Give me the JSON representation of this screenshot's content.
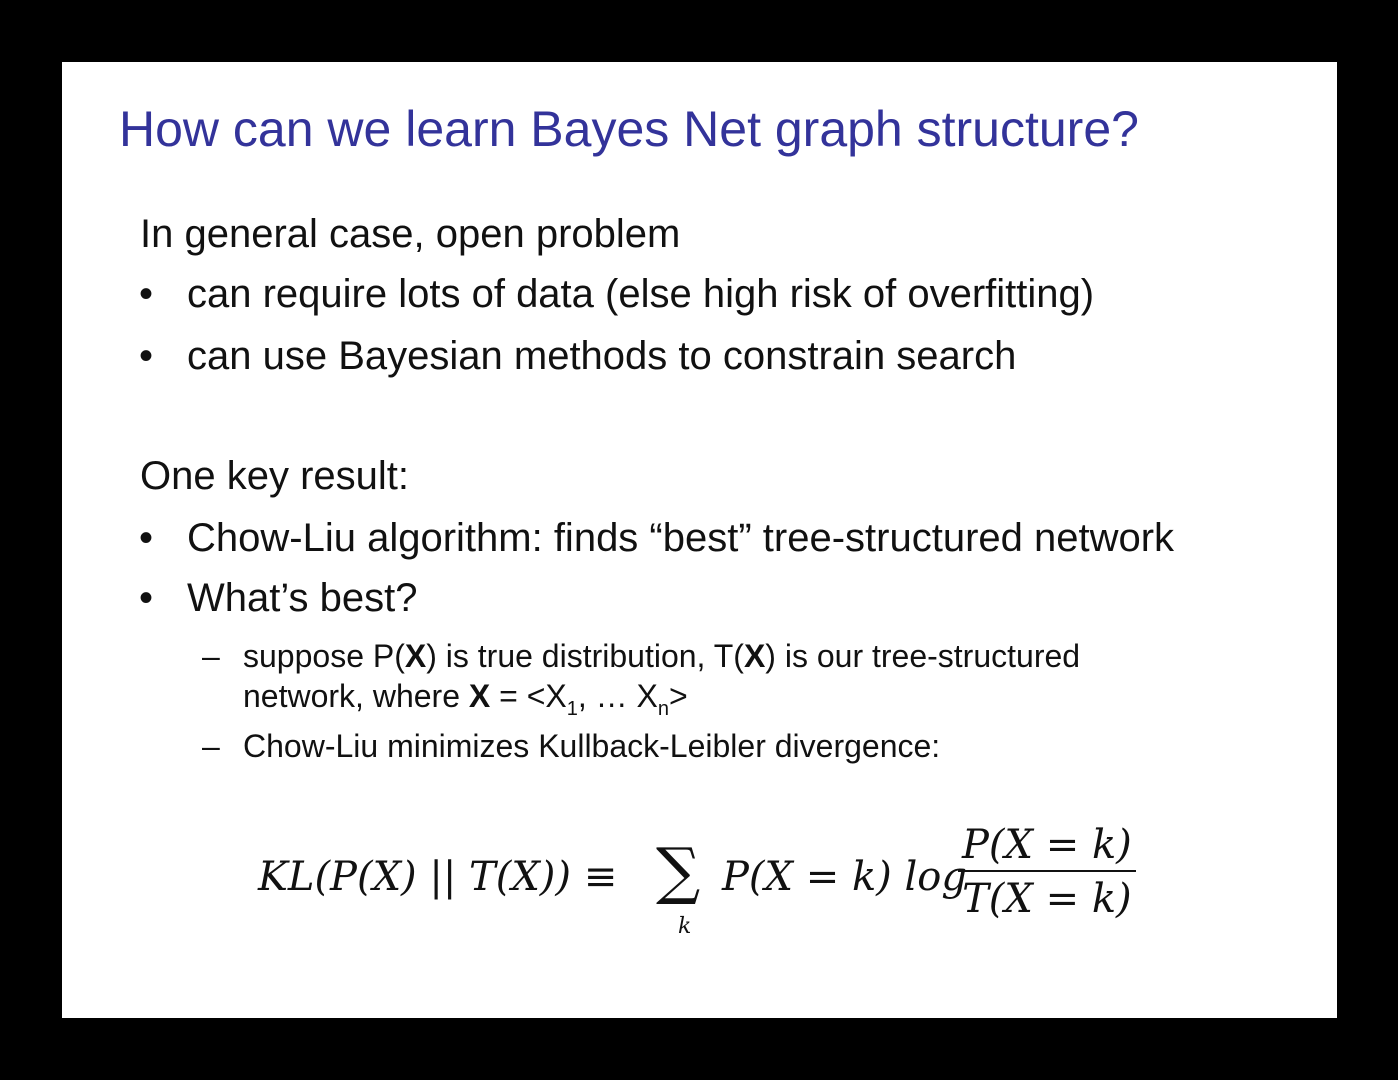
{
  "title": "How can we learn Bayes Net graph structure?",
  "section1": {
    "heading": "In general case, open problem",
    "bullets": [
      "can require lots of data (else high risk of overfitting)",
      "can use Bayesian methods to constrain search"
    ]
  },
  "section2": {
    "heading": "One key result:",
    "bullets": [
      "Chow-Liu algorithm: finds “best” tree-structured network",
      "What’s best?"
    ],
    "sub_bullets": {
      "item1_part1": "suppose P(",
      "item1_bold_x1": "X",
      "item1_part2": ") is true distribution, T(",
      "item1_bold_x2": "X",
      "item1_part3": ") is our tree-structured",
      "item1_line2_part1": "network, where ",
      "item1_line2_bold_x": "X",
      "item1_line2_part2": " = <X",
      "item1_line2_sub1": "1",
      "item1_line2_part3": ", … X",
      "item1_line2_subn": "n",
      "item1_line2_part4": ">",
      "item2": "Chow-Liu minimizes Kullback-Leibler divergence:"
    }
  },
  "formula": {
    "lhs_text": "KL(P(X) || T(X)) ≡",
    "sum_symbol": "∑",
    "sum_index": "k",
    "rhs_text": "P(X = k) log",
    "numerator": "P(X = k)",
    "denominator": "T(X = k)"
  },
  "colors": {
    "title": "#33339a",
    "background": "#000000",
    "slide": "#ffffff"
  }
}
